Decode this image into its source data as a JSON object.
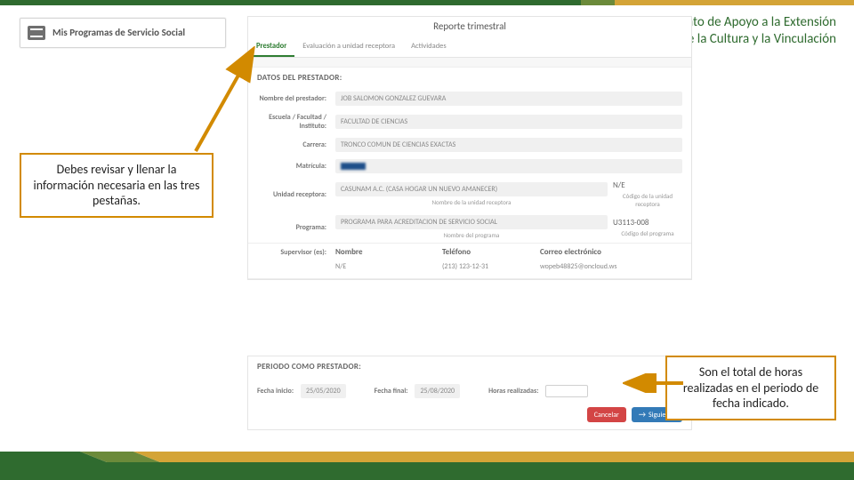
{
  "department": {
    "line1": "Departamento de Apoyo a la Extensión",
    "line2": "de la Cultura y la Vinculación"
  },
  "menu": {
    "title": "Mis Programas de Servicio Social"
  },
  "form": {
    "title": "Reporte trimestral",
    "tabs": {
      "t1": "Prestador",
      "t2": "Evaluación a unidad receptora",
      "t3": "Actividades"
    },
    "section1": "DATOS DEL PRESTADOR:",
    "labels": {
      "nombre": "Nombre del prestador:",
      "escuela": "Escuela / Facultad / Instituto:",
      "carrera": "Carrera:",
      "matricula": "Matrícula:",
      "unidad": "Unidad receptora:",
      "programa": "Programa:",
      "supervisor": "Supervisor (es):"
    },
    "values": {
      "nombre": "JOB SALOMON GONZALEZ GUEVARA",
      "escuela": "FACULTAD DE CIENCIAS",
      "carrera": "TRONCO COMUN DE CIENCIAS EXACTAS",
      "unidad": "CASUNAM A.C. (CASA HOGAR UN NUEVO AMANECER)",
      "unidad_code": "N/E",
      "unidad_sub": "Nombre de la unidad receptora",
      "unidad_code_sub": "Código de la unidad receptora",
      "programa": "PROGRAMA PARA ACREDITACION DE SERVICIO SOCIAL",
      "programa_code": "U3113-008",
      "programa_sub": "Nombre del programa",
      "programa_code_sub": "Código del programa"
    },
    "supervisor": {
      "h_nombre": "Nombre",
      "h_tel": "Teléfono",
      "h_mail": "Correo electrónico",
      "nombre": "N/E",
      "tel": "(213) 123-12-31",
      "mail": "wopeb48825@oncloud.ws"
    }
  },
  "period": {
    "section": "PERIODO COMO PRESTADOR:",
    "l_inicio": "Fecha inicio:",
    "v_inicio": "25/05/2020",
    "l_final": "Fecha final:",
    "v_final": "25/08/2020",
    "l_horas": "Horas realizadas:"
  },
  "buttons": {
    "cancel": "Cancelar",
    "next": "Siguiente"
  },
  "callouts": {
    "left": "Debes revisar y llenar la información necesaria en las tres pestañas.",
    "right": "Son el total de horas realizadas en el periodo de fecha indicado."
  }
}
